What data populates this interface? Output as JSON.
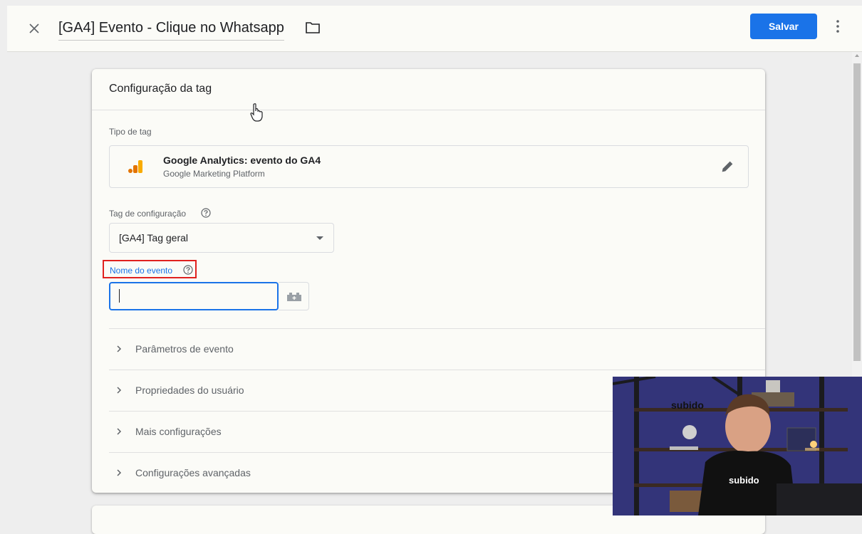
{
  "header": {
    "close_icon": "close-icon",
    "title": "[GA4] Evento - Clique no Whatsapp",
    "folder_icon": "folder-icon",
    "save_label": "Salvar",
    "more_icon": "more-vert-icon"
  },
  "card": {
    "title": "Configuração da tag",
    "tag_type_label": "Tipo de tag",
    "tag_type": {
      "name": "Google Analytics: evento do GA4",
      "subtitle": "Google Marketing Platform",
      "icon": "google-analytics-icon",
      "edit_icon": "edit-pencil-icon"
    },
    "config_tag_label": "Tag de configuração",
    "config_tag_value": "[GA4] Tag geral",
    "event_name_label": "Nome do evento",
    "event_name_value": "",
    "sections": [
      {
        "label": "Parâmetros de evento"
      },
      {
        "label": "Propriedades do usuário"
      },
      {
        "label": "Mais configurações"
      },
      {
        "label": "Configurações avançadas"
      }
    ]
  },
  "webcam": {
    "sign_text": "subido",
    "shirt_text": "subido"
  },
  "colors": {
    "primary": "#1a73e8",
    "highlight_box": "#e0211f",
    "ga_orange": "#f9ab00",
    "ga_dark_orange": "#e37400"
  }
}
